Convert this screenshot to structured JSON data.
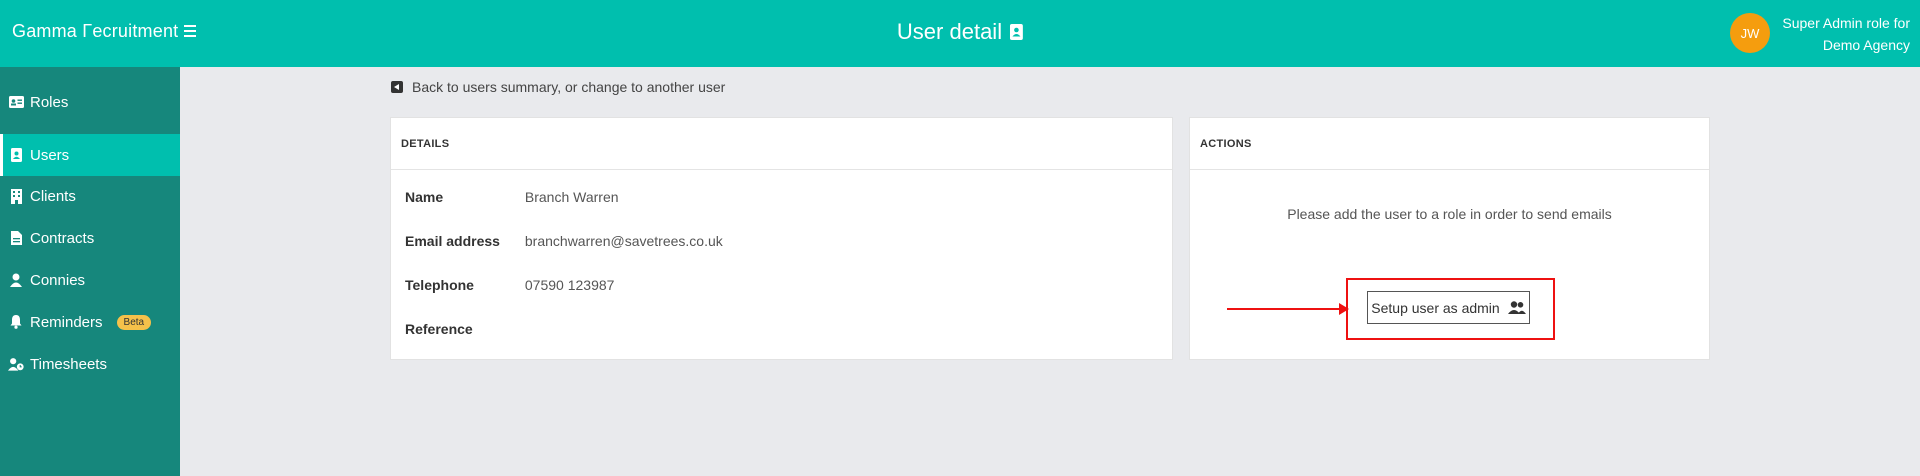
{
  "app": {
    "brand": "Gamma Γecruitment",
    "page_title": "User detail",
    "avatar_initials": "JW",
    "role_line1": "Super Admin role for",
    "role_line2": "Demo Agency"
  },
  "sidebar": {
    "items": [
      {
        "label": "Roles",
        "icon": "id-card-icon"
      },
      {
        "label": "Users",
        "icon": "address-book-icon",
        "active": true
      },
      {
        "label": "Clients",
        "icon": "building-icon"
      },
      {
        "label": "Contracts",
        "icon": "file-icon"
      },
      {
        "label": "Connies",
        "icon": "user-icon"
      },
      {
        "label": "Reminders",
        "icon": "bell-icon",
        "badge": "Beta"
      },
      {
        "label": "Timesheets",
        "icon": "user-clock-icon"
      }
    ]
  },
  "back_link": "Back to users summary, or change to another user",
  "details": {
    "heading": "DETAILS",
    "fields": [
      {
        "label": "Name",
        "value": "Branch Warren"
      },
      {
        "label": "Email address",
        "value": "branchwarren@savetrees.co.uk"
      },
      {
        "label": "Telephone",
        "value": "07590 123987"
      },
      {
        "label": "Reference",
        "value": ""
      }
    ]
  },
  "actions": {
    "heading": "ACTIONS",
    "message": "Please add the user to a role in order to send emails",
    "setup_button": "Setup user as admin",
    "setup_icon": "users-icon"
  },
  "colors": {
    "topbar": "#00bfae",
    "sidebar": "#16877c",
    "avatar": "#f59d0e",
    "annotation": "#ee1111"
  }
}
